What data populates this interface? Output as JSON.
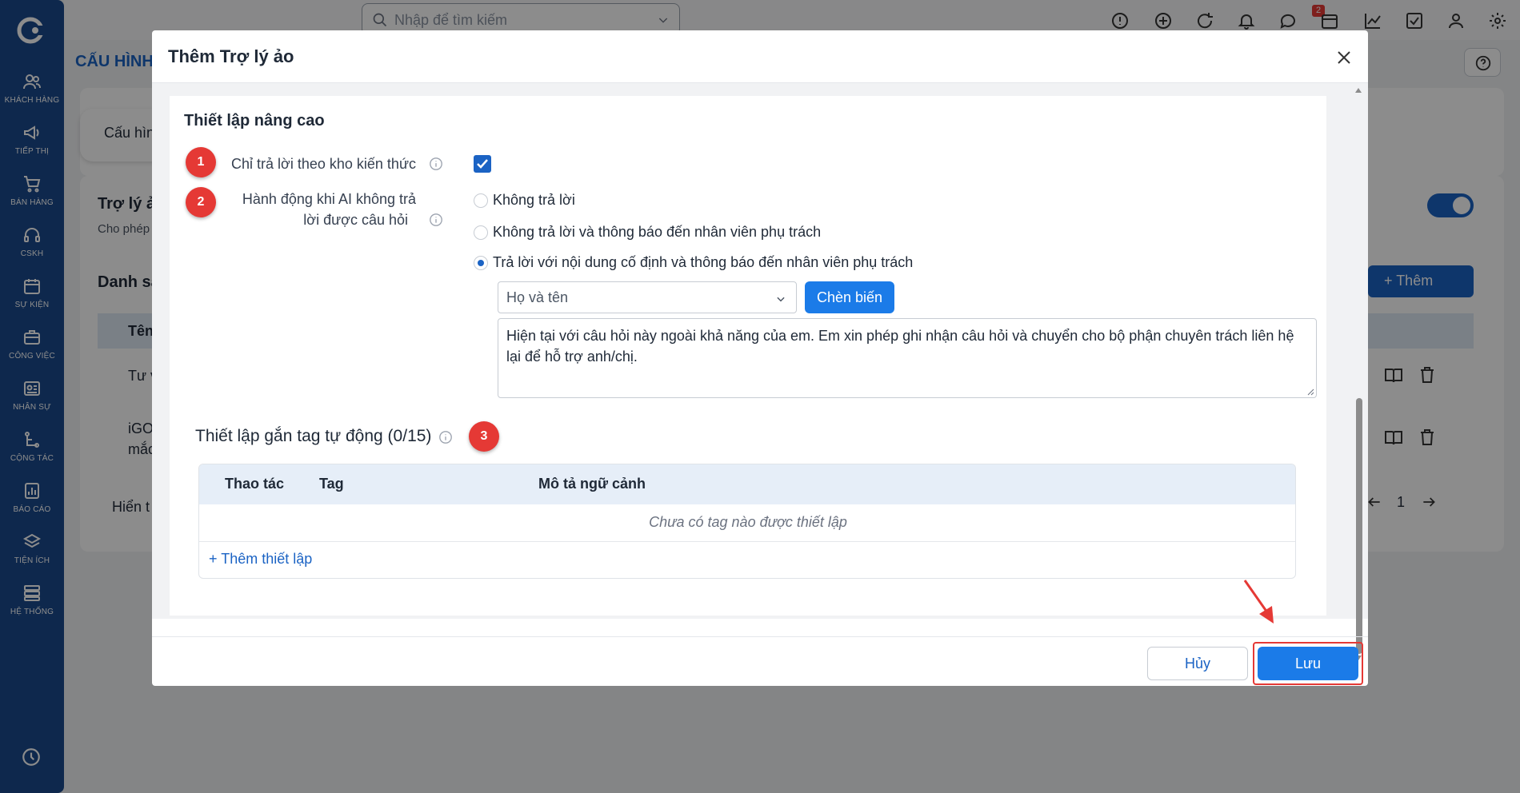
{
  "search": {
    "placeholder": "Nhập để tìm kiếm"
  },
  "notifications": {
    "count": "2"
  },
  "sidebar": {
    "items": [
      {
        "label": "KHÁCH HÀNG",
        "icon": "users-icon"
      },
      {
        "label": "TIẾP THỊ",
        "icon": "megaphone-icon"
      },
      {
        "label": "BÁN HÀNG",
        "icon": "cart-icon"
      },
      {
        "label": "CSKH",
        "icon": "headset-icon"
      },
      {
        "label": "SỰ KIỆN",
        "icon": "calendar-icon"
      },
      {
        "label": "CÔNG VIỆC",
        "icon": "briefcase-icon"
      },
      {
        "label": "NHÂN SỰ",
        "icon": "id-card-icon"
      },
      {
        "label": "CỘNG TÁC",
        "icon": "collaboration-icon"
      },
      {
        "label": "BÁO CÁO",
        "icon": "report-icon"
      },
      {
        "label": "TIỆN ÍCH",
        "icon": "layers-icon"
      },
      {
        "label": "HỆ THỐNG",
        "icon": "server-icon"
      }
    ]
  },
  "background": {
    "page_title": "CẤU HÌNH",
    "tab_label": "Cấu hìn",
    "card_title": "Trợ lý ả",
    "card_subtitle": "Cho phép",
    "list_title": "Danh sá",
    "add_button": "Thêm",
    "table_header_name": "Tên",
    "row1": "Tư v",
    "row2_line1": "iGO",
    "row2_line2": "mắc",
    "footer_text": "Hiển t",
    "page_number": "1"
  },
  "modal": {
    "title": "Thêm Trợ lý ảo",
    "section_title": "Thiết lập nâng cao",
    "badges": [
      "1",
      "2",
      "3"
    ],
    "only_kb_label": "Chỉ trả lời theo kho kiến thức",
    "only_kb_checked": true,
    "action_label_line1": "Hành động khi AI không trả",
    "action_label_line2": "lời được câu hỏi",
    "options": [
      {
        "label": "Không trả lời",
        "checked": false
      },
      {
        "label": "Không trả lời và thông báo đến nhân viên phụ trách",
        "checked": false
      },
      {
        "label": "Trả lời với nội dung cố định và thông báo đến nhân viên phụ trách",
        "checked": true
      }
    ],
    "variable_select": "Họ và tên",
    "insert_button": "Chèn biến",
    "message": "Hiện tại với câu hỏi này ngoài khả năng của em. Em xin phép ghi nhận câu hỏi và chuyển cho bộ phận chuyên trách liên hệ lại để hỗ trợ anh/chị.",
    "tag_section_title": "Thiết lập gắn tag tự động (0/15)",
    "tag_table": {
      "columns": [
        "Thao tác",
        "Tag",
        "Mô tả ngữ cảnh"
      ],
      "empty_text": "Chưa có tag nào được thiết lập",
      "add_link": "Thêm thiết lập"
    },
    "cancel_button": "Hủy",
    "save_button": "Lưu"
  },
  "colors": {
    "primary": "#1b63c4",
    "button_blue": "#1b7be8",
    "sidebar": "#1b4a8c",
    "highlight_red": "#e53935"
  }
}
